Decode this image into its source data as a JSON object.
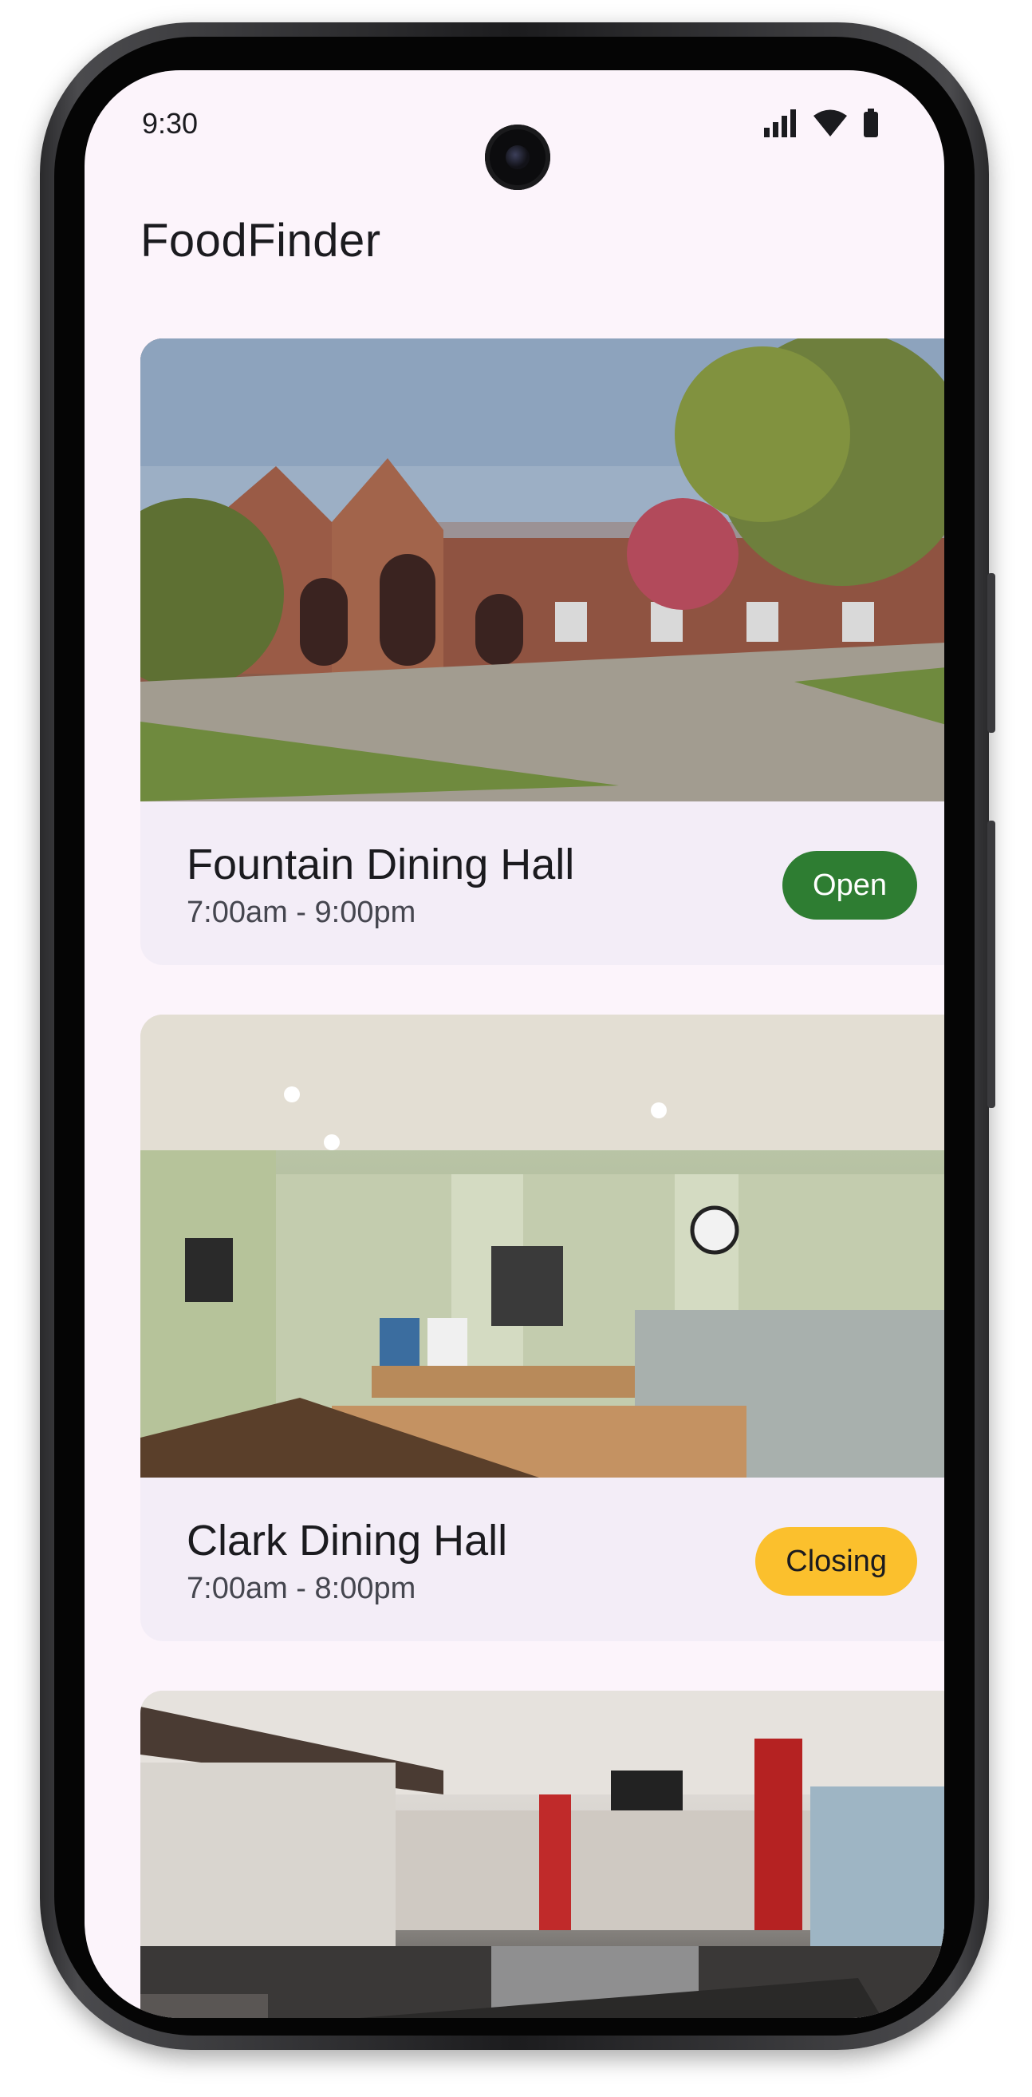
{
  "status_bar": {
    "time": "9:30"
  },
  "app": {
    "title": "FoodFinder"
  },
  "locations": [
    {
      "name": "Fountain Dining Hall",
      "hours": "7:00am - 9:00pm",
      "status": "Open"
    },
    {
      "name": "Clark Dining Hall",
      "hours": "7:00am - 8:00pm",
      "status": "Closing"
    },
    {
      "name": "",
      "hours": "",
      "status": ""
    }
  ],
  "colors": {
    "background": "#fcf4fb",
    "card": "#f3edf7",
    "open": "#2e7d32",
    "closing": "#fbc02d"
  },
  "icons": [
    "signal-icon",
    "wifi-icon",
    "battery-icon"
  ]
}
